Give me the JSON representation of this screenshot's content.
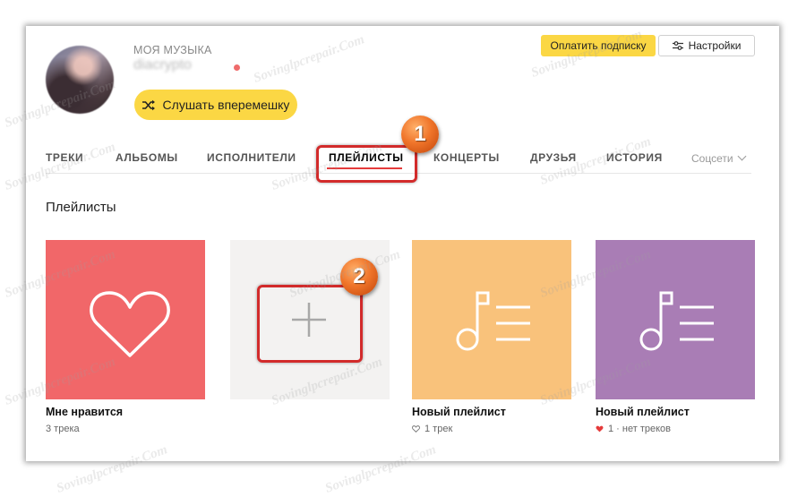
{
  "header": {
    "section_label": "МОЯ МУЗЫКА",
    "username": "diacrypto",
    "shuffle_label": "Слушать вперемешку",
    "subscribe_label": "Оплатить подписку",
    "settings_label": "Настройки"
  },
  "tabs": [
    {
      "label": "ТРЕКИ",
      "active": false
    },
    {
      "label": "АЛЬБОМЫ",
      "active": false
    },
    {
      "label": "ИСПОЛНИТЕЛИ",
      "active": false
    },
    {
      "label": "ПЛЕЙЛИСТЫ",
      "active": true
    },
    {
      "label": "КОНЦЕРТЫ",
      "active": false
    },
    {
      "label": "ДРУЗЬЯ",
      "active": false
    },
    {
      "label": "ИСТОРИЯ",
      "active": false
    }
  ],
  "social_label": "Соцсети",
  "section_title": "Плейлисты",
  "playlists": [
    {
      "title": "Мне нравится",
      "subtitle": "3 трека",
      "cover_icon": "heart-icon",
      "cover_color": "#f16769"
    },
    {
      "title": "",
      "subtitle": "",
      "cover_icon": "plus-icon",
      "cover_color": "#f3f2f1"
    },
    {
      "title": "Новый плейлист",
      "subtitle": "1 трек",
      "subtitle_icon": "heart-outline-icon",
      "cover_icon": "playlist-icon",
      "cover_color": "#f9c27b"
    },
    {
      "title": "Новый плейлист",
      "subtitle": "1 · нет треков",
      "subtitle_icon": "heart-filled-icon",
      "cover_icon": "playlist-icon",
      "cover_color": "#a97db5"
    }
  ],
  "annotations": {
    "marker_1": "1",
    "marker_2": "2"
  },
  "watermark_text": "Sovinglpcrepair.Com",
  "colors": {
    "accent_yellow": "#fbd744",
    "active_underline": "#e53b3b",
    "marker_red": "#d22b2b"
  }
}
